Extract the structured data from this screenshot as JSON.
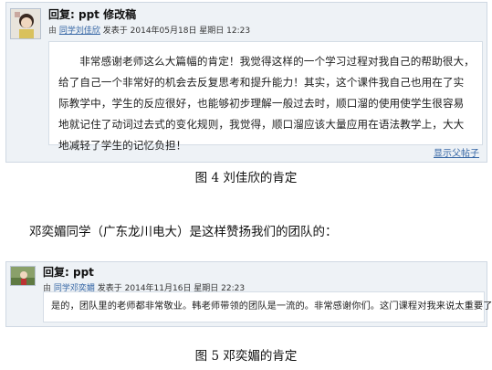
{
  "post1": {
    "title": "回复: ppt 修改稿",
    "meta_by": "由",
    "author": "同学刘佳欣",
    "meta_time": "发表于 2014年05月18日 星期日 12:23",
    "body": "非常感谢老师这么大篇幅的肯定！我觉得这样的一个学习过程对我自己的帮助很大，给了自己一个非常好的机会去反复思考和提升能力！其实，这个课件我自己也用在了实际教学中，学生的反应很好，也能够初步理解一般过去时，顺口溜的使用使学生很容易地就记住了动词过去式的变化规则，我觉得，顺口溜应该大量应用在语法教学上，大大地减轻了学生的记忆负担！",
    "parent_link": "显示父帖子"
  },
  "caption1": "图 4  刘佳欣的肯定",
  "paragraph": "邓奕媚同学（广东龙川电大）是这样赞扬我们的团队的：",
  "post2": {
    "title": "回复: ppt",
    "meta_by": "由",
    "author": "同学邓奕媚",
    "meta_time": "发表于 2014年11月16日 星期日 22:23",
    "body": "是的，团队里的老师都非常敬业。韩老师带领的团队是一流的。非常感谢你们。这门课程对我来说太重要了。"
  },
  "caption2": "图 5  邓奕媚的肯定"
}
